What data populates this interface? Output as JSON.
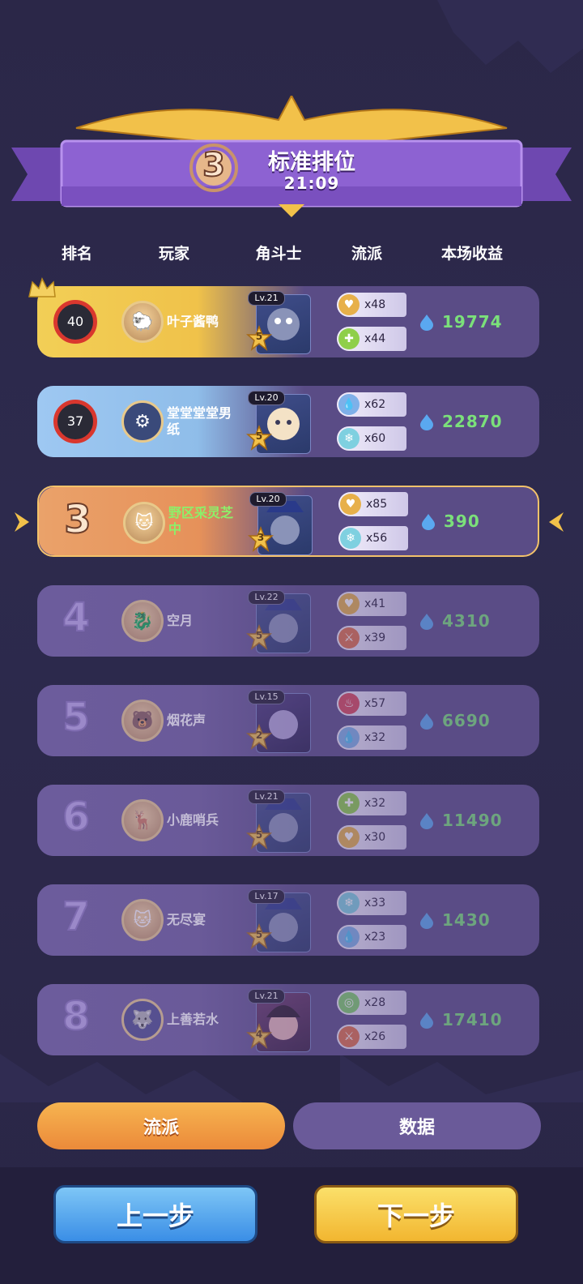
{
  "header": {
    "rank_number": "3",
    "title": "标准排位",
    "time": "21:09"
  },
  "columns": {
    "rank": "排名",
    "player": "玩家",
    "fighter": "角斗士",
    "traits": "流派",
    "earnings": "本场收益"
  },
  "rows": [
    {
      "rank_hp": "40",
      "name": "叶子酱鸭",
      "level": "Lv.21",
      "stars": "5",
      "trait1": {
        "icon": "heart-icon",
        "count": "x48",
        "color": "#e7b04a"
      },
      "trait2": {
        "icon": "plus-icon",
        "count": "x44",
        "color": "#8fcf4a"
      },
      "earnings": "19774"
    },
    {
      "rank_hp": "37",
      "name": "堂堂堂堂男纸",
      "level": "Lv.20",
      "stars": "5",
      "trait1": {
        "icon": "water-drop-icon",
        "count": "x62",
        "color": "#7fb0e8"
      },
      "trait2": {
        "icon": "snowflake-icon",
        "count": "x60",
        "color": "#7fd0e0"
      },
      "earnings": "22870"
    },
    {
      "rank": "3",
      "name": "野区采灵芝中",
      "level": "Lv.20",
      "stars": "3",
      "trait1": {
        "icon": "heart-icon",
        "count": "x85",
        "color": "#e7b04a"
      },
      "trait2": {
        "icon": "snowflake-icon",
        "count": "x56",
        "color": "#7fd0e0"
      },
      "earnings": "390"
    },
    {
      "rank": "4",
      "name": "空月",
      "level": "Lv.22",
      "stars": "5",
      "trait1": {
        "icon": "heart-icon",
        "count": "x41",
        "color": "#e7b04a"
      },
      "trait2": {
        "icon": "claw-icon",
        "count": "x39",
        "color": "#e0704a"
      },
      "earnings": "4310"
    },
    {
      "rank": "5",
      "name": "烟花声",
      "level": "Lv.15",
      "stars": "2",
      "trait1": {
        "icon": "flame-icon",
        "count": "x57",
        "color": "#d9485a"
      },
      "trait2": {
        "icon": "water-drop-icon",
        "count": "x32",
        "color": "#7fb0e8"
      },
      "earnings": "6690"
    },
    {
      "rank": "6",
      "name": "小鹿哨兵",
      "level": "Lv.21",
      "stars": "5",
      "trait1": {
        "icon": "plus-icon",
        "count": "x32",
        "color": "#8fcf4a"
      },
      "trait2": {
        "icon": "heart-icon",
        "count": "x30",
        "color": "#e7b04a"
      },
      "earnings": "11490"
    },
    {
      "rank": "7",
      "name": "无尽宴",
      "level": "Lv.17",
      "stars": "5",
      "trait1": {
        "icon": "snowflake-icon",
        "count": "x33",
        "color": "#7fd0e0"
      },
      "trait2": {
        "icon": "water-drop-icon",
        "count": "x23",
        "color": "#7fb0e8"
      },
      "earnings": "1430"
    },
    {
      "rank": "8",
      "name": "上善若水",
      "level": "Lv.21",
      "stars": "4",
      "trait1": {
        "icon": "ring-icon",
        "count": "x28",
        "color": "#7fcf6a"
      },
      "trait2": {
        "icon": "claw-icon",
        "count": "x26",
        "color": "#e0704a"
      },
      "earnings": "17410"
    }
  ],
  "tabs": {
    "traits": "流派",
    "data": "数据"
  },
  "buttons": {
    "prev": "上一步",
    "next": "下一步"
  },
  "colors": {
    "banner_purple": "#8d62d2",
    "earnings_green": "#7be07a",
    "gold": "#f0c040",
    "highlight_orange": "#e8905a"
  }
}
